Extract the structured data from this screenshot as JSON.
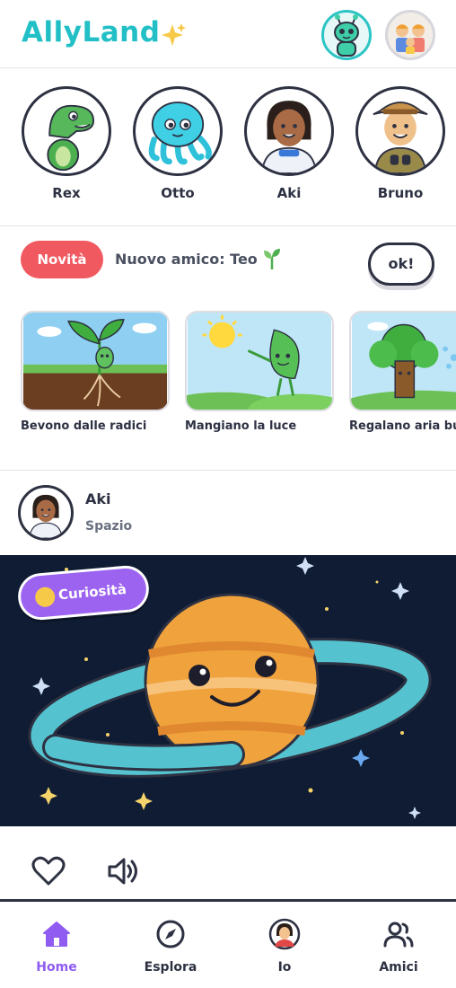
{
  "app": {
    "title": "AllyLand",
    "accent": "#22c0c6",
    "purple": "#8f5bf0",
    "red": "#f0595f"
  },
  "header": {
    "bot_avatar_icon": "alien-robot-avatar",
    "family_avatar_icon": "family-avatar"
  },
  "friends": [
    {
      "name": "Rex",
      "icon": "dinosaur-avatar"
    },
    {
      "name": "Otto",
      "icon": "octopus-avatar"
    },
    {
      "name": "Aki",
      "icon": "astronaut-girl-avatar"
    },
    {
      "name": "Bruno",
      "icon": "explorer-boy-avatar"
    }
  ],
  "news": {
    "badge": "Novità",
    "text": "Nuovo amico: Teo",
    "ok_label": "ok!",
    "cards": [
      {
        "caption": "Bevono dalle radici",
        "icon": "plant-roots-illustration"
      },
      {
        "caption": "Mangiano la luce",
        "icon": "leaf-sun-illustration"
      },
      {
        "caption": "Regalano aria bu",
        "icon": "tree-air-illustration"
      }
    ]
  },
  "post": {
    "author": "Aki",
    "topic": "Spazio",
    "tag": "Curiosità",
    "image_icon": "saturn-illustration"
  },
  "actions": {
    "like_icon": "heart-icon",
    "audio_icon": "speaker-icon"
  },
  "nav": [
    {
      "label": "Home",
      "icon": "home-icon",
      "active": true
    },
    {
      "label": "Esplora",
      "icon": "compass-icon",
      "active": false
    },
    {
      "label": "Io",
      "icon": "profile-avatar-icon",
      "active": false
    },
    {
      "label": "Amici",
      "icon": "friends-icon",
      "active": false
    }
  ]
}
